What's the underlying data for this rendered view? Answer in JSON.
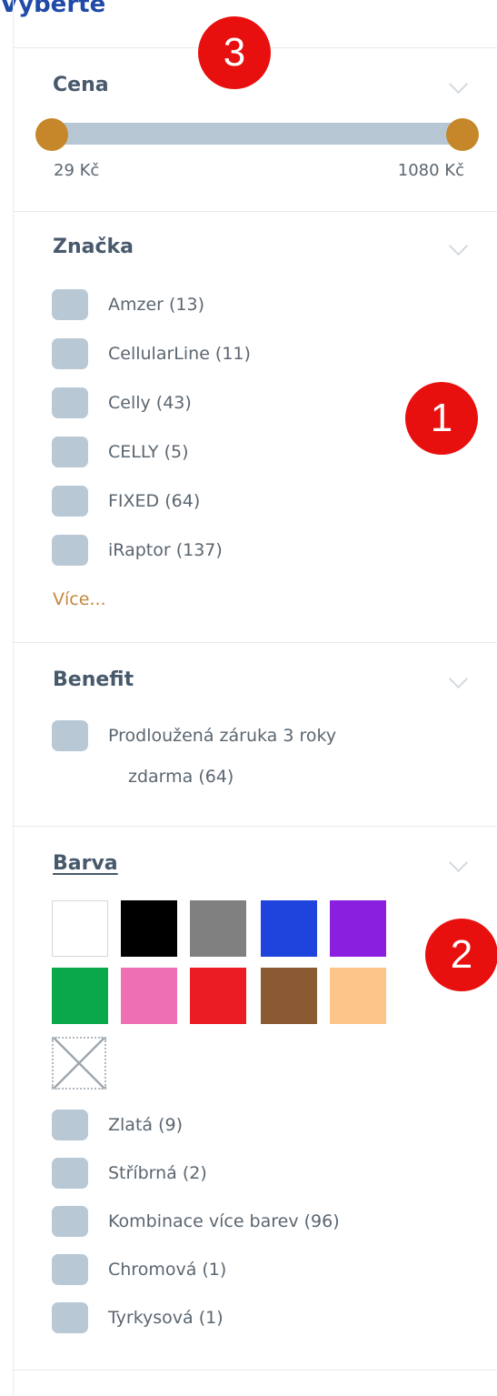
{
  "page_heading_partial": "Vyberte",
  "filters": {
    "price": {
      "title": "Cena",
      "min_label": "29 Kč",
      "max_label": "1080 Kč",
      "range_selected": [
        0,
        1
      ]
    },
    "brand": {
      "title": "Značka",
      "items": [
        {
          "label": "Amzer (13)"
        },
        {
          "label": "CellularLine (11)"
        },
        {
          "label": "Celly (43)"
        },
        {
          "label": "CELLY (5)"
        },
        {
          "label": "FIXED (64)"
        },
        {
          "label": "iRaptor (137)"
        }
      ],
      "more_label": "Více..."
    },
    "benefit": {
      "title": "Benefit",
      "items": [
        {
          "label_line1": "Prodloužená záruka 3 roky",
          "label_line2": "zdarma (64)"
        }
      ]
    },
    "color": {
      "title": "Barva",
      "swatches": [
        {
          "name": "white",
          "color": "#ffffff"
        },
        {
          "name": "black",
          "color": "#000000"
        },
        {
          "name": "gray",
          "color": "#808080"
        },
        {
          "name": "blue",
          "color": "#1e44dd"
        },
        {
          "name": "purple",
          "color": "#8b1fe0"
        },
        {
          "name": "green",
          "color": "#0aa84a"
        },
        {
          "name": "pink",
          "color": "#ee6fb3"
        },
        {
          "name": "red",
          "color": "#ec1c24"
        },
        {
          "name": "brown",
          "color": "#8a5a33"
        },
        {
          "name": "peach",
          "color": "#fdc58a"
        },
        {
          "name": "none-pattern-icon",
          "color": "#ffffff"
        }
      ],
      "items": [
        {
          "label": "Zlatá (9)"
        },
        {
          "label": "Stříbrná (2)"
        },
        {
          "label": "Kombinace více barev (96)"
        },
        {
          "label": "Chromová (1)"
        },
        {
          "label": "Tyrkysová (1)"
        }
      ]
    }
  },
  "annotations": {
    "badge_1": "1",
    "badge_2": "2",
    "badge_3": "3"
  },
  "colors": {
    "checkbox": "#b9c8d5",
    "slider_track": "#b6c6d3",
    "slider_knob": "#c5872a",
    "more_link": "#c5873c",
    "badge": "#e8100e",
    "heading": "#48596c"
  }
}
